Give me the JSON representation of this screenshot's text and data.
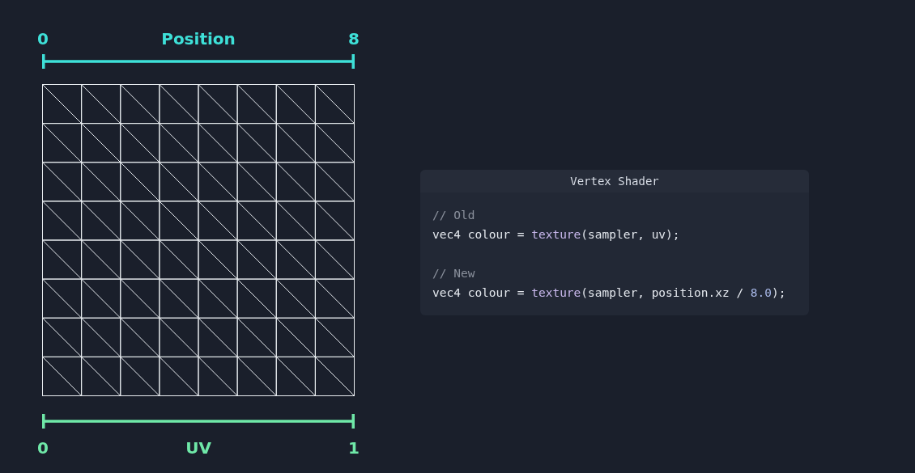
{
  "position_axis": {
    "start_label": "0",
    "title": "Position",
    "end_label": "8",
    "color": "#3ee0d8"
  },
  "uv_axis": {
    "start_label": "0",
    "title": "UV",
    "end_label": "1",
    "color": "#6fe8a8"
  },
  "code_panel": {
    "title": "Vertex Shader",
    "lines": [
      {
        "kind": "code",
        "tokens": [
          {
            "kind": "comment",
            "text": "// Old"
          }
        ]
      },
      {
        "kind": "code",
        "tokens": [
          {
            "kind": "plain",
            "text": "vec4 colour = "
          },
          {
            "kind": "function",
            "text": "texture"
          },
          {
            "kind": "plain",
            "text": "(sampler, uv);"
          }
        ]
      },
      {
        "kind": "blank"
      },
      {
        "kind": "code",
        "tokens": [
          {
            "kind": "comment",
            "text": "// New"
          }
        ]
      },
      {
        "kind": "code",
        "tokens": [
          {
            "kind": "plain",
            "text": "vec4 colour = "
          },
          {
            "kind": "function",
            "text": "texture"
          },
          {
            "kind": "plain",
            "text": "(sampler, position.xz / "
          },
          {
            "kind": "number",
            "text": "8.0"
          },
          {
            "kind": "plain",
            "text": ");"
          }
        ]
      }
    ]
  }
}
